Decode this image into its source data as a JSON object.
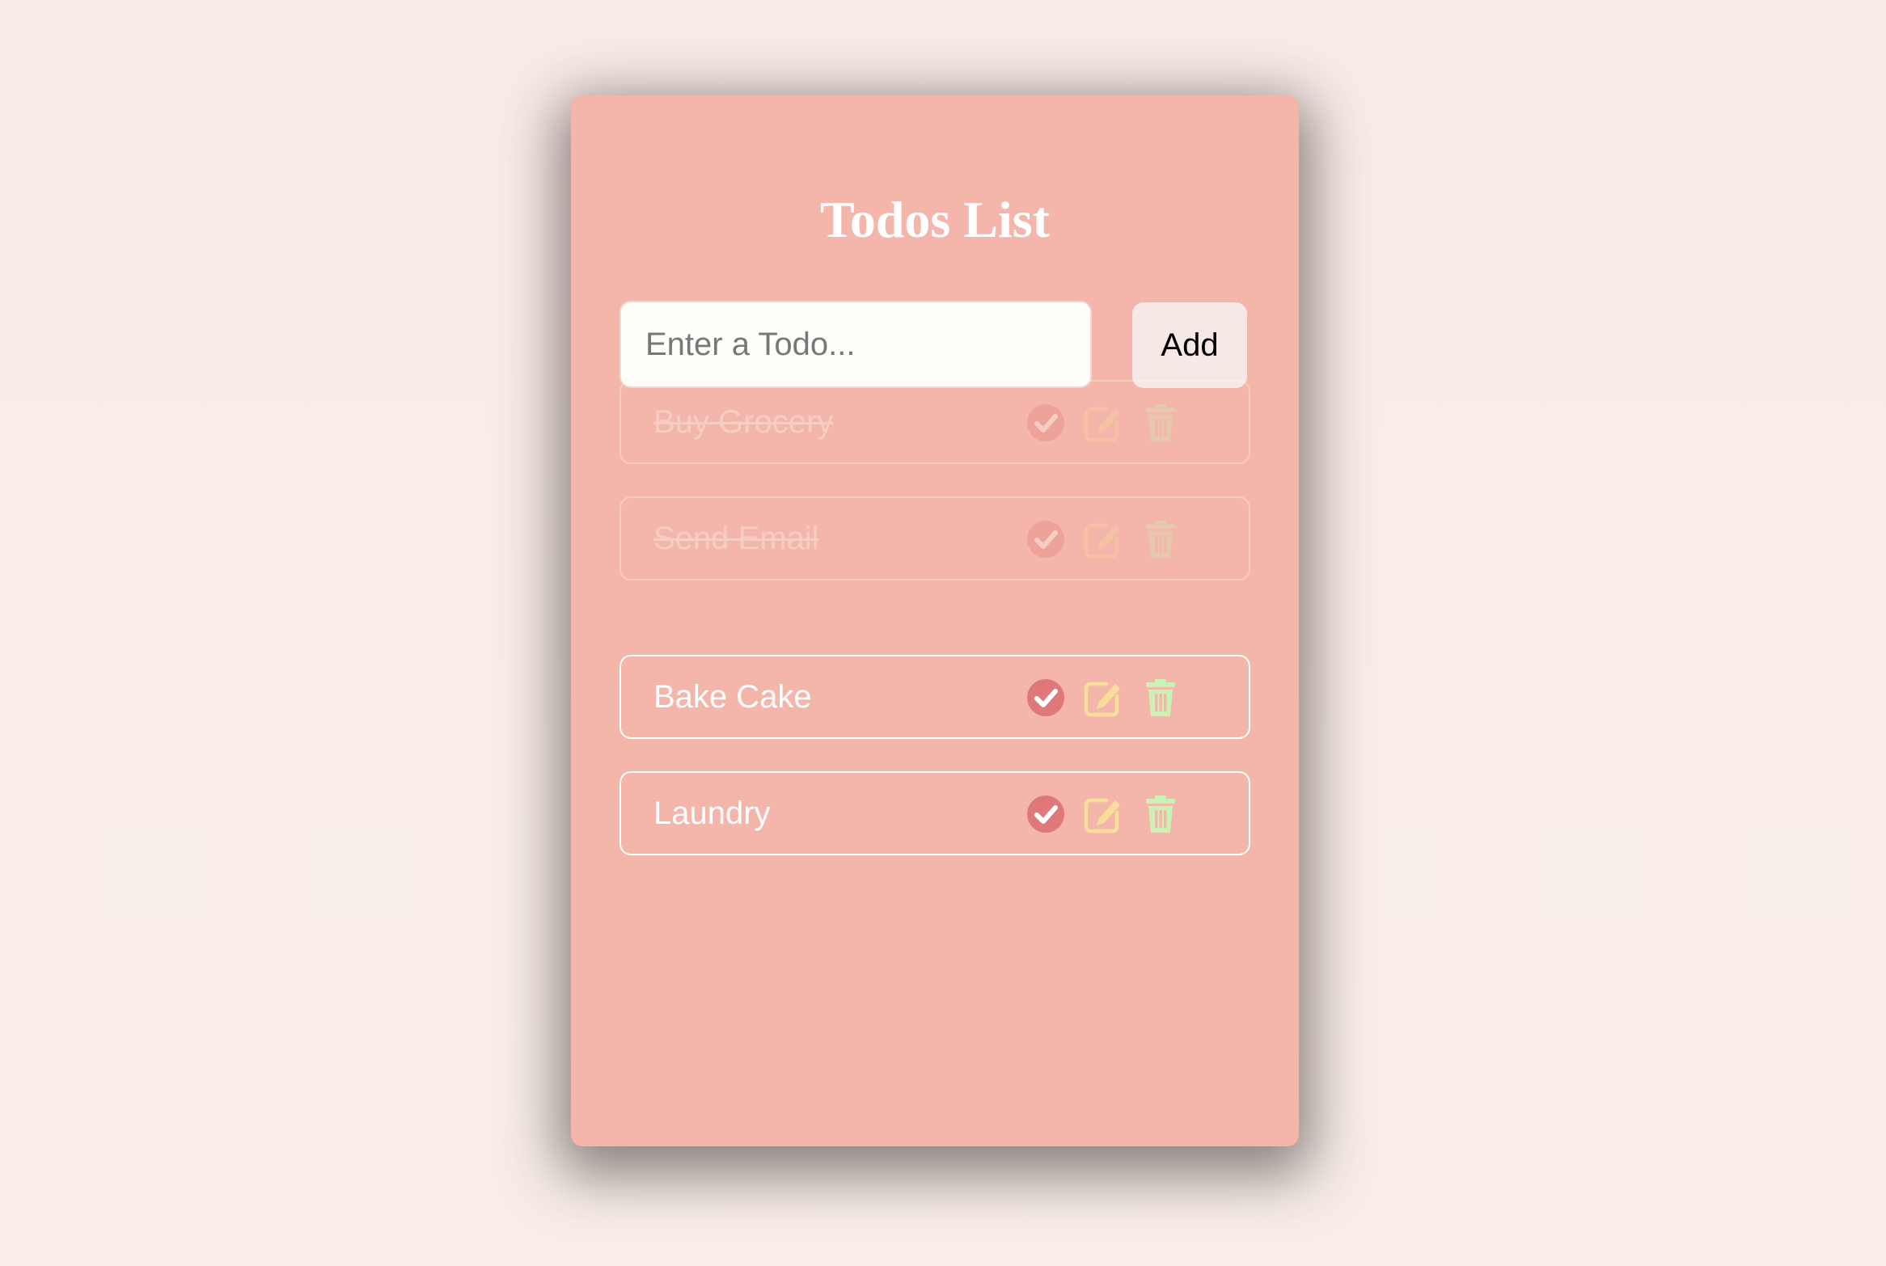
{
  "app": {
    "title": "Todos List"
  },
  "input": {
    "placeholder": "Enter a Todo...",
    "value": ""
  },
  "add_button": {
    "label": "Add"
  },
  "colors": {
    "background": "#f8ede8",
    "card": "#f4b6aa",
    "check_icon": "#df7878",
    "edit_icon": "#f9dd9b",
    "delete_icon": "#c9f2b5",
    "text": "#ffffff"
  },
  "todos": [
    {
      "text": "Buy Grocery",
      "completed": true
    },
    {
      "text": "Send Email",
      "completed": true
    },
    {
      "text": "Bake Cake",
      "completed": false
    },
    {
      "text": "Laundry",
      "completed": false
    }
  ],
  "icons": {
    "complete": "check-circle-icon",
    "edit": "edit-icon",
    "delete": "trash-icon"
  }
}
